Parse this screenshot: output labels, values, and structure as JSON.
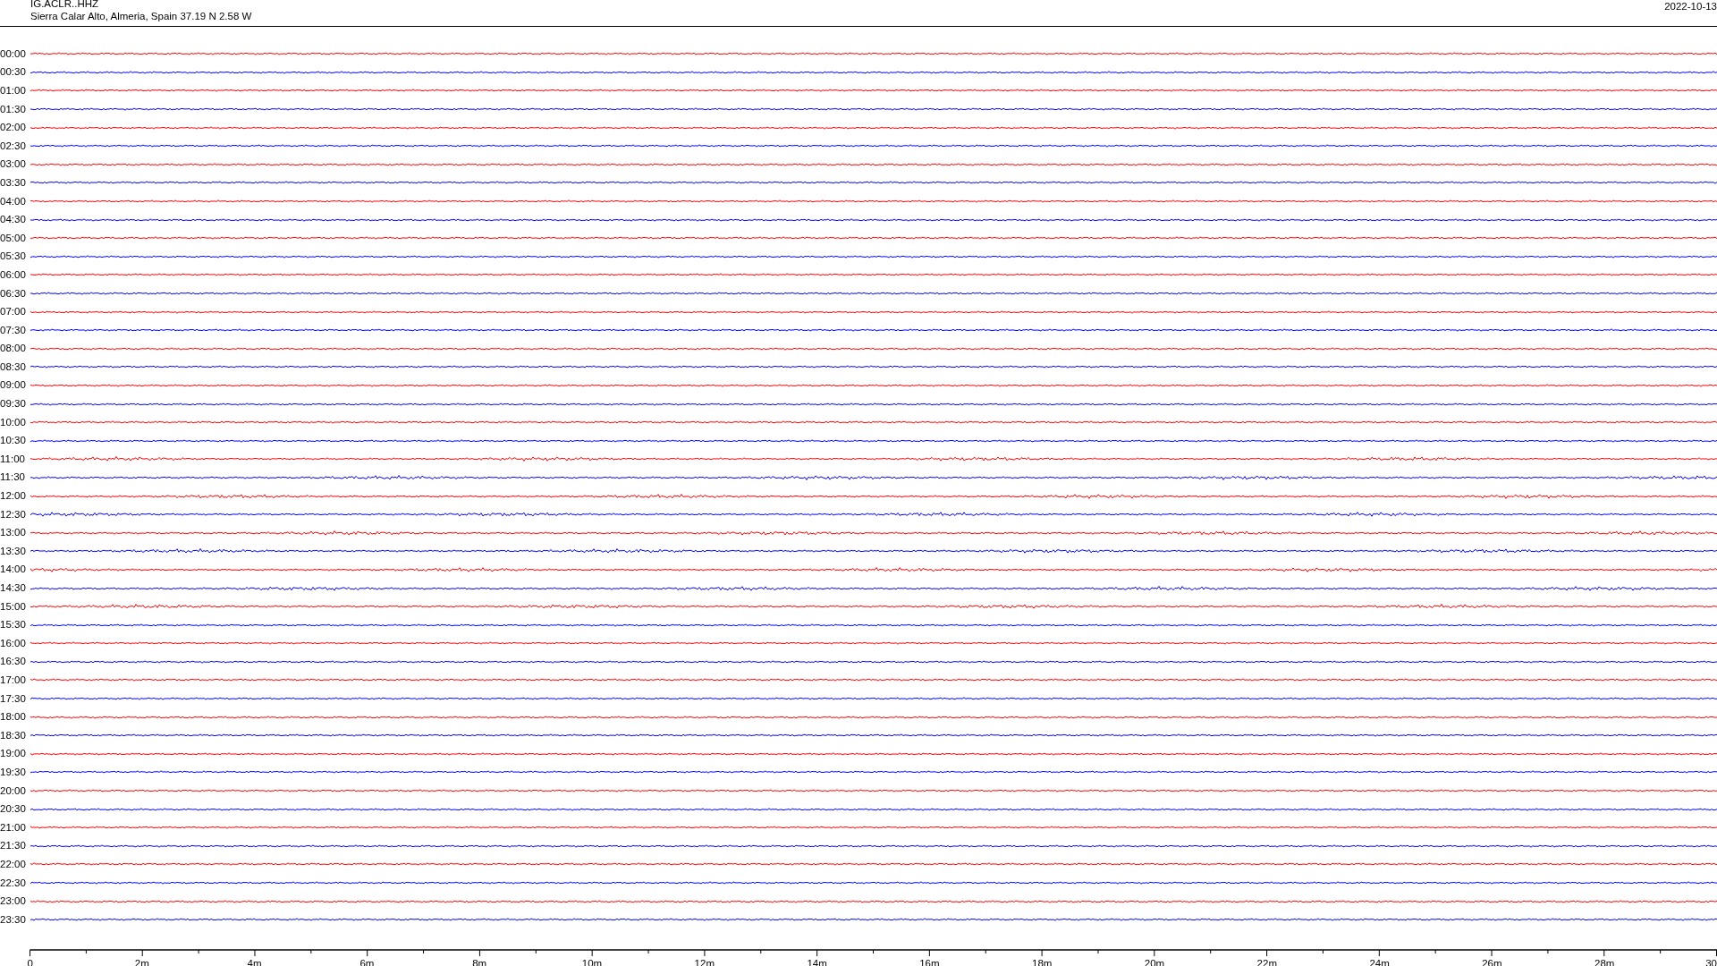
{
  "header": {
    "station": "IG.ACLR..HHZ",
    "location": "Sierra Calar Alto, Almeria, Spain  37.19 N 2.58 W",
    "date": "2022-10-13"
  },
  "rows": [
    {
      "time": "00:00",
      "color": "#ff0000"
    },
    {
      "time": "00:30",
      "color": "#0000ff"
    },
    {
      "time": "01:00",
      "color": "#ff0000"
    },
    {
      "time": "01:30",
      "color": "#0000ff"
    },
    {
      "time": "02:00",
      "color": "#ff0000"
    },
    {
      "time": "02:30",
      "color": "#0000ff"
    },
    {
      "time": "03:00",
      "color": "#ff0000"
    },
    {
      "time": "03:30",
      "color": "#0000ff"
    },
    {
      "time": "04:00",
      "color": "#ff0000"
    },
    {
      "time": "04:30",
      "color": "#0000ff"
    },
    {
      "time": "05:00",
      "color": "#ff0000"
    },
    {
      "time": "05:30",
      "color": "#0000ff"
    },
    {
      "time": "06:00",
      "color": "#ff0000"
    },
    {
      "time": "06:30",
      "color": "#0000ff"
    },
    {
      "time": "07:00",
      "color": "#ff0000"
    },
    {
      "time": "07:30",
      "color": "#0000ff"
    },
    {
      "time": "08:00",
      "color": "#ff0000"
    },
    {
      "time": "08:30",
      "color": "#0000ff"
    },
    {
      "time": "09:00",
      "color": "#ff0000"
    },
    {
      "time": "09:30",
      "color": "#0000ff"
    },
    {
      "time": "10:00",
      "color": "#ff0000"
    },
    {
      "time": "10:30",
      "color": "#0000ff"
    },
    {
      "time": "11:00",
      "color": "#ff0000"
    },
    {
      "time": "11:30",
      "color": "#0000ff"
    },
    {
      "time": "12:00",
      "color": "#ff0000"
    },
    {
      "time": "12:30",
      "color": "#0000ff"
    },
    {
      "time": "13:00",
      "color": "#ff0000"
    },
    {
      "time": "13:30",
      "color": "#0000ff"
    },
    {
      "time": "14:00",
      "color": "#ff0000"
    },
    {
      "time": "14:30",
      "color": "#0000ff"
    },
    {
      "time": "15:00",
      "color": "#ff0000"
    },
    {
      "time": "15:30",
      "color": "#0000ff"
    },
    {
      "time": "16:00",
      "color": "#ff0000"
    },
    {
      "time": "16:30",
      "color": "#0000ff"
    },
    {
      "time": "17:00",
      "color": "#ff0000"
    },
    {
      "time": "17:30",
      "color": "#0000ff"
    },
    {
      "time": "18:00",
      "color": "#ff0000"
    },
    {
      "time": "18:30",
      "color": "#0000ff"
    },
    {
      "time": "19:00",
      "color": "#ff0000"
    },
    {
      "time": "19:30",
      "color": "#0000ff"
    },
    {
      "time": "20:00",
      "color": "#ff0000"
    },
    {
      "time": "20:30",
      "color": "#0000ff"
    },
    {
      "time": "21:00",
      "color": "#ff0000"
    },
    {
      "time": "21:30",
      "color": "#0000ff"
    },
    {
      "time": "22:00",
      "color": "#ff0000"
    },
    {
      "time": "22:30",
      "color": "#0000ff"
    },
    {
      "time": "23:00",
      "color": "#ff0000"
    },
    {
      "time": "23:30",
      "color": "#0000ff"
    }
  ],
  "axis": {
    "labels": [
      "0",
      "2m",
      "4m",
      "6m",
      "8m",
      "10m",
      "12m",
      "14m",
      "16m",
      "18m",
      "20m",
      "22m",
      "24m",
      "26m",
      "28m",
      "30"
    ]
  }
}
